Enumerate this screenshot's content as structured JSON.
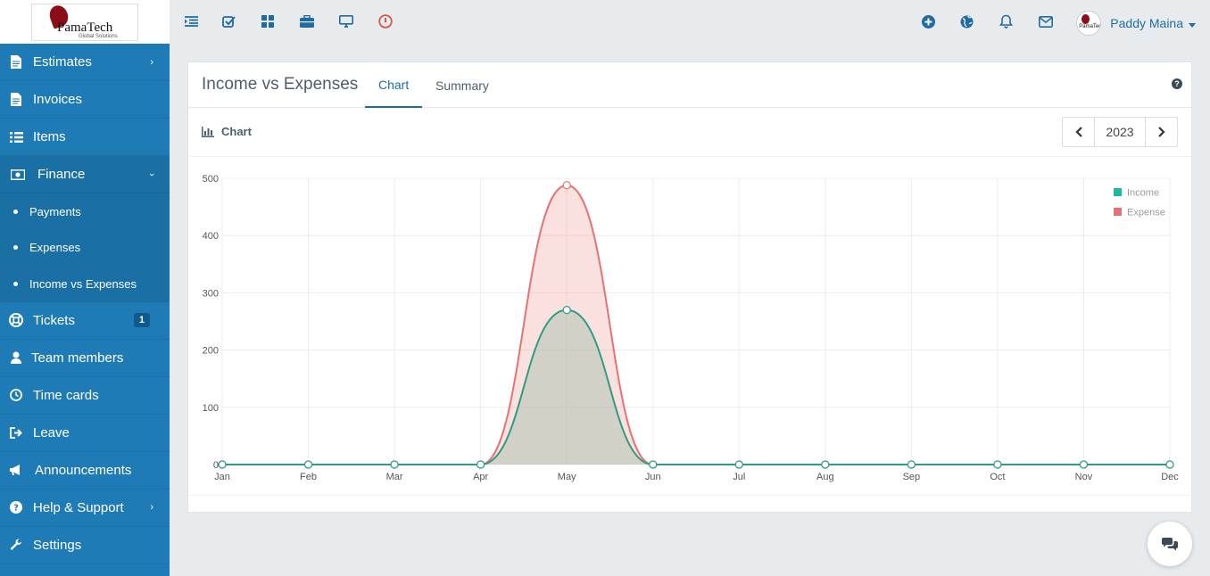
{
  "brand": {
    "logo_text": "PamaTech",
    "logo_sub": "Global Solutions"
  },
  "sidebar": {
    "items": [
      {
        "label": "Estimates",
        "icon": "file-icon",
        "has_chevron": true
      },
      {
        "label": "Invoices",
        "icon": "file-icon"
      },
      {
        "label": "Items",
        "icon": "list-icon"
      },
      {
        "label": "Finance",
        "icon": "money-icon",
        "expanded": true
      },
      {
        "label": "Tickets",
        "icon": "life-ring-icon",
        "badge": "1"
      },
      {
        "label": "Team members",
        "icon": "user-icon"
      },
      {
        "label": "Time cards",
        "icon": "clock-icon"
      },
      {
        "label": "Leave",
        "icon": "sign-out-icon"
      },
      {
        "label": "Announcements",
        "icon": "bullhorn-icon"
      },
      {
        "label": "Help & Support",
        "icon": "question-circle-icon",
        "has_chevron": true
      },
      {
        "label": "Settings",
        "icon": "wrench-icon"
      }
    ],
    "finance_sub": [
      "Payments",
      "Expenses",
      "Income vs Expenses"
    ]
  },
  "topbar": {
    "user_name": "Paddy Maina"
  },
  "page": {
    "title": "Income vs Expenses",
    "tabs": [
      "Chart",
      "Summary"
    ],
    "section_title": "Chart",
    "year": "2023"
  },
  "colors": {
    "sidebar": "#1f7bb5",
    "accent": "#1f6ca3",
    "income": "#1abc9c",
    "expense": "#e57373"
  },
  "chart_data": {
    "type": "area",
    "categories": [
      "Jan",
      "Feb",
      "Mar",
      "Apr",
      "May",
      "Jun",
      "Jul",
      "Aug",
      "Sep",
      "Oct",
      "Nov",
      "Dec"
    ],
    "series": [
      {
        "name": "Income",
        "values": [
          0,
          0,
          0,
          0,
          270,
          0,
          0,
          0,
          0,
          0,
          0,
          0
        ]
      },
      {
        "name": "Expense",
        "values": [
          0,
          0,
          0,
          0,
          488,
          0,
          0,
          0,
          0,
          0,
          0,
          0
        ]
      }
    ],
    "yticks": [
      "0",
      "100",
      "200",
      "300",
      "400",
      "500"
    ],
    "ylim": [
      0,
      500
    ],
    "grid": true,
    "legend": "top-right"
  }
}
